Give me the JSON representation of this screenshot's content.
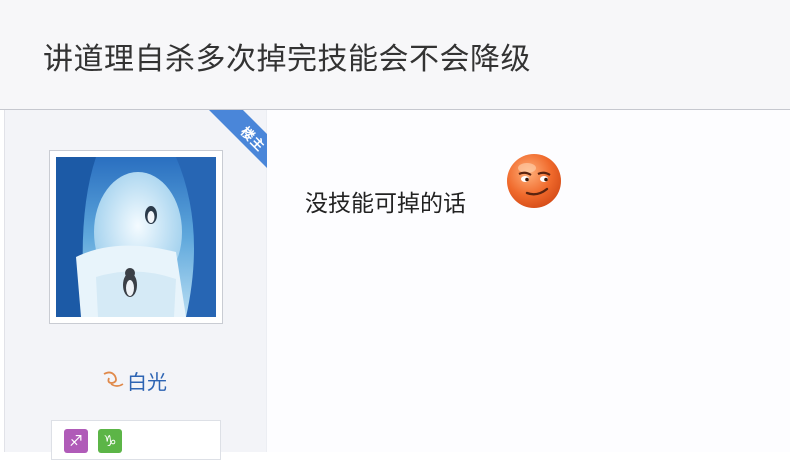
{
  "thread": {
    "title": "讲道理自杀多次掉完技能会不会降级"
  },
  "post": {
    "badge_label": "楼主",
    "author": {
      "name": "白光",
      "name_icon": "level-swirl-icon",
      "avatar": "ice-cave-penguin-avatar",
      "badges": [
        {
          "name": "sagittarius-icon",
          "symbol": "♐",
          "color": "#b05bb8"
        },
        {
          "name": "capricorn-icon",
          "symbol": "♑",
          "color": "#5cb547"
        }
      ]
    },
    "content": "没技能可掉的话",
    "emoji": "smirk-emoji"
  },
  "colors": {
    "ribbon": "#4a86d9",
    "username": "#2d64b3",
    "title_bg": "#f7f7f9"
  }
}
